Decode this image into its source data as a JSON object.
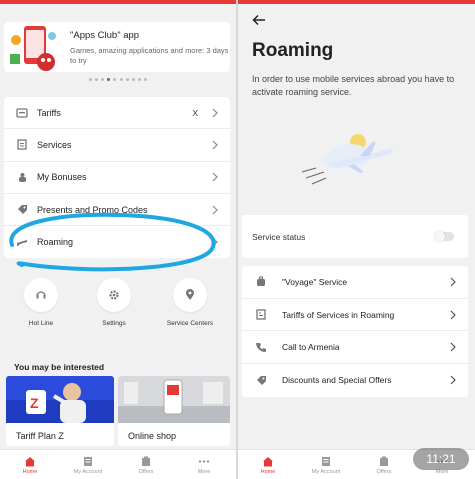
{
  "left_screen": {
    "promo": {
      "title": "\"Apps Club\" app",
      "description": "Games, amazing applications and more: 3 days to try",
      "carousel_dots": 10,
      "active_dot": 3
    },
    "menu": [
      {
        "label": "Tariffs",
        "icon": "sim-card-icon",
        "badge": "X"
      },
      {
        "label": "Services",
        "icon": "document-icon",
        "badge": ""
      },
      {
        "label": "My Bonuses",
        "icon": "piggy-bank-icon",
        "badge": ""
      },
      {
        "label": "Presents and Promo Codes",
        "icon": "tag-icon",
        "badge": ""
      },
      {
        "label": "Roaming",
        "icon": "airplane-icon",
        "badge": ""
      }
    ],
    "quick_actions": [
      {
        "label": "Hot Line",
        "icon": "headset-icon"
      },
      {
        "label": "Settings",
        "icon": "gear-icon"
      },
      {
        "label": "Service Centers",
        "icon": "location-pin-icon"
      }
    ],
    "interest_title": "You may be interested",
    "cards": [
      {
        "label": "Tariff Plan Z"
      },
      {
        "label": "Online shop"
      }
    ]
  },
  "right_screen": {
    "title": "Roaming",
    "description": "In order to use mobile services abroad you have to activate roaming service.",
    "service_status_label": "Service status",
    "service_status_on": false,
    "menu": [
      {
        "label": "\"Voyage\" Service",
        "icon": "suitcase-icon"
      },
      {
        "label": "Tariffs of Services in Roaming",
        "icon": "price-list-icon"
      },
      {
        "label": "Call to Armenia",
        "icon": "phone-icon"
      },
      {
        "label": "Discounts and Special Offers",
        "icon": "tag-icon"
      }
    ]
  },
  "tabbar": [
    {
      "label": "Home",
      "icon": "home-icon",
      "active": true
    },
    {
      "label": "My Account",
      "icon": "account-icon",
      "active": false
    },
    {
      "label": "Offers",
      "icon": "offers-icon",
      "active": false
    },
    {
      "label": "More",
      "icon": "more-dots-icon",
      "active": false
    }
  ],
  "clock": "11:21",
  "colors": {
    "accent": "#e53935",
    "scribble": "#1ea7e1"
  }
}
